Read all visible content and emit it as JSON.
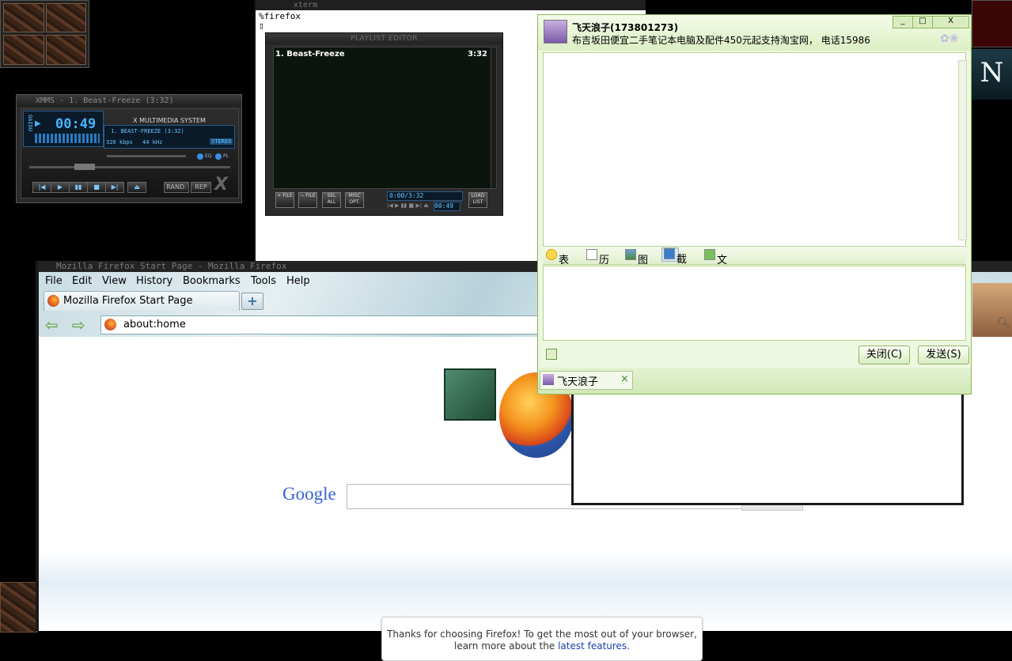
{
  "xmms": {
    "title": "XMMS - 1. Beast-Freeze (3:32)",
    "time": "00:49",
    "brand": "X MULTIMEDIA SYSTEM",
    "track": "1. BEAST-FREEZE (3:32)",
    "bitrate": "320 kbps",
    "samplerate": "44 kHz",
    "mode": "STEREO",
    "eq_label": "EQ",
    "pl_label": "PL",
    "rand_label": "RAND.",
    "rep_label": "REP",
    "display_label": "OAIDU",
    "corner_logo": "X"
  },
  "xterm": {
    "title": "xterm",
    "line1": "%firefox",
    "cursor": "▯"
  },
  "playlist": {
    "title": "PLAYLIST EDITOR",
    "items": [
      {
        "name": "1. Beast-Freeze",
        "duration": "3:32"
      }
    ],
    "buttons": [
      "+ FILE",
      "− FILE",
      "SEL ALL",
      "MISC OPT.",
      "LOAD LIST"
    ],
    "time_total": "0:00/3:32",
    "time_elapsed": "00:49"
  },
  "firefox": {
    "title": "Mozilla Firefox Start Page - Mozilla Firefox",
    "menu": [
      "File",
      "Edit",
      "View",
      "History",
      "Bookmarks",
      "Tools",
      "Help"
    ],
    "tab_title": "Mozilla Firefox Start Page",
    "new_tab_symbol": "+",
    "url": "about:home",
    "search_brand": "Google",
    "snippet_text": "Thanks for choosing Firefox! To get the most out of your browser, learn more about the",
    "snippet_link": "latest features",
    "snippet_end": "."
  },
  "qq": {
    "contact_name": "飞天浪子(173801273)",
    "status_message": "布吉坂田便宜二手笔记本电脑及配件450元起支持淘宝网， 电话15986",
    "toolbar": [
      "表情",
      "历史",
      "图片",
      "截屏",
      "文件"
    ],
    "close_button": "关闭(C)",
    "send_button": "发送(S)",
    "tab_label": "飞天浪子",
    "tab_close": "×",
    "win_controls": [
      "_",
      "□",
      "X"
    ]
  },
  "desktop": {
    "n_icon_label": "N"
  }
}
